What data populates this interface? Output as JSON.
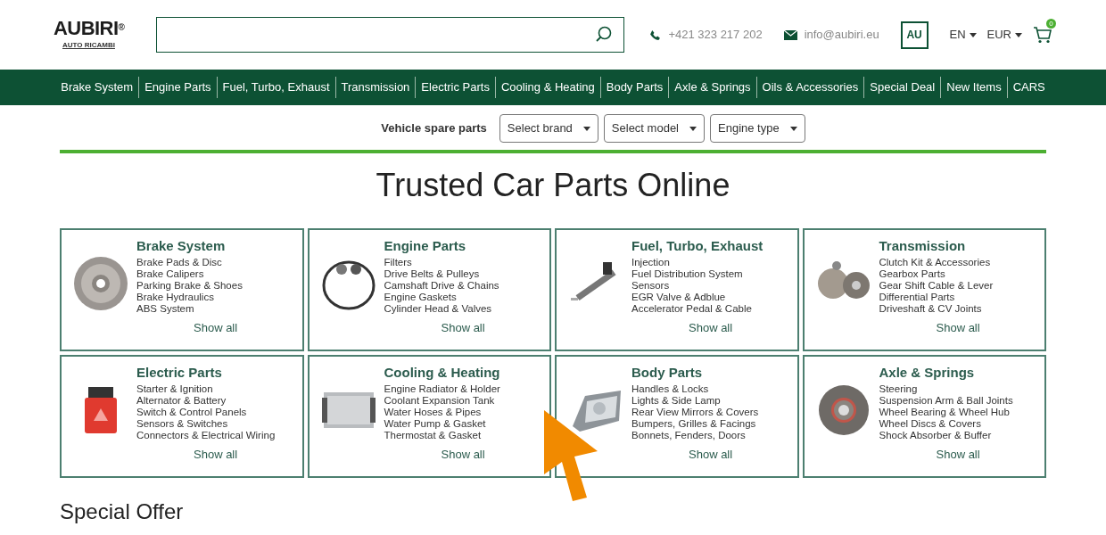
{
  "logo": {
    "name": "AUBIRI",
    "mark": "®",
    "tagline": "AUTO RICAMBI"
  },
  "contact": {
    "phone": "+421 323 217 202",
    "email": "info@aubiri.eu"
  },
  "account": "AU",
  "language": "EN",
  "currency": "EUR",
  "cart_count": "0",
  "nav": [
    "Brake System",
    "Engine Parts",
    "Fuel, Turbo, Exhaust",
    "Transmission",
    "Electric Parts",
    "Cooling & Heating",
    "Body Parts",
    "Axle & Springs",
    "Oils & Accessories",
    "Special Deal",
    "New Items",
    "CARS"
  ],
  "vehicle_selector": {
    "label": "Vehicle spare parts",
    "selects": [
      "Select brand",
      "Select model",
      "Engine type"
    ]
  },
  "heading": "Trusted Car Parts Online",
  "categories": [
    {
      "title": "Brake System",
      "items": [
        "Brake Pads & Disc",
        "Brake Calipers",
        "Parking Brake & Shoes",
        "Brake Hydraulics",
        "ABS System"
      ],
      "link": "Show all"
    },
    {
      "title": "Engine Parts",
      "items": [
        "Filters",
        "Drive Belts & Pulleys",
        "Camshaft Drive & Chains",
        "Engine Gaskets",
        "Cylinder Head & Valves"
      ],
      "link": "Show all"
    },
    {
      "title": "Fuel, Turbo, Exhaust",
      "items": [
        "Injection",
        "Fuel Distribution System",
        "Sensors",
        "EGR Valve & Adblue",
        "Accelerator Pedal & Cable"
      ],
      "link": "Show all"
    },
    {
      "title": "Transmission",
      "items": [
        "Clutch Kit & Accessories",
        "Gearbox Parts",
        "Gear Shift Cable & Lever",
        "Differential Parts",
        "Driveshaft & CV Joints"
      ],
      "link": "Show all"
    },
    {
      "title": "Electric Parts",
      "items": [
        "Starter & Ignition",
        "Alternator & Battery",
        "Switch & Control Panels",
        "Sensors & Switches",
        "Connectors & Electrical Wiring"
      ],
      "link": "Show all"
    },
    {
      "title": "Cooling & Heating",
      "items": [
        "Engine Radiator & Holder",
        "Coolant Expansion Tank",
        "Water Hoses & Pipes",
        "Water Pump & Gasket",
        "Thermostat & Gasket"
      ],
      "link": "Show all"
    },
    {
      "title": "Body Parts",
      "items": [
        "Handles & Locks",
        "Lights & Side Lamp",
        "Rear View Mirrors & Covers",
        "Bumpers, Grilles & Facings",
        "Bonnets, Fenders, Doors"
      ],
      "link": "Show all"
    },
    {
      "title": "Axle & Springs",
      "items": [
        "Steering",
        "Suspension Arm & Ball Joints",
        "Wheel Bearing & Wheel Hub",
        "Wheel Discs & Covers",
        "Shock Absorber & Buffer"
      ],
      "link": "Show all"
    }
  ],
  "section_heading": "Special Offer"
}
